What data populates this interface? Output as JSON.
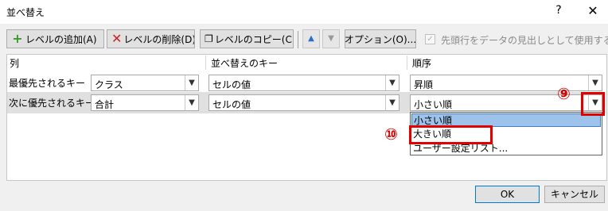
{
  "window": {
    "title": "並べ替え",
    "help_icon": "?",
    "close_icon": "✕"
  },
  "toolbar": {
    "add_level": "レベルの追加(A)",
    "delete_level": "レベルの削除(D)",
    "copy_level": "レベルのコピー(C)",
    "options": "オプション(O)...",
    "header_checkbox_label": "先頭行をデータの見出しとして使用する(H)"
  },
  "grid": {
    "headers": {
      "column": "列",
      "sort_on": "並べ替えのキー",
      "order": "順序"
    },
    "rows": [
      {
        "label": "最優先されるキー",
        "column": "クラス",
        "sort_on": "セルの値",
        "order": "昇順"
      },
      {
        "label": "次に優先されるキー",
        "column": "合計",
        "sort_on": "セルの値",
        "order": "小さい順"
      }
    ]
  },
  "dropdown": {
    "options": [
      "小さい順",
      "大きい順",
      "ユーザー設定リスト..."
    ],
    "selected_index": 0
  },
  "annotations": {
    "callout_9": "⑨",
    "callout_10": "⑩",
    "highlight_color": "#e00000"
  },
  "buttons": {
    "ok": "OK",
    "cancel": "キャンセル"
  },
  "colors": {
    "accent_border": "#0078d7",
    "selection_fill": "#9ec3ea"
  }
}
